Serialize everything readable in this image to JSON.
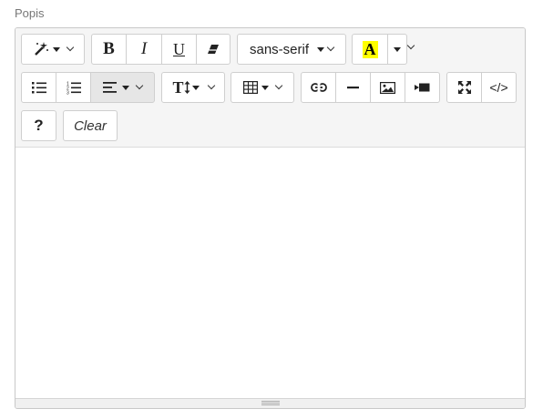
{
  "field": {
    "label": "Popis"
  },
  "toolbar": {
    "style": {
      "icon": "magic-wand-icon"
    },
    "bold": {
      "label": "B",
      "icon": "bold-icon"
    },
    "italic": {
      "label": "I",
      "icon": "italic-icon"
    },
    "underline": {
      "label": "U",
      "icon": "underline-icon"
    },
    "eraser": {
      "icon": "eraser-icon"
    },
    "font": {
      "name": "sans-serif"
    },
    "color": {
      "label": "A",
      "highlight": "#ffff00"
    },
    "unordered_list": {
      "icon": "unordered-list-icon"
    },
    "ordered_list": {
      "icon": "ordered-list-icon"
    },
    "paragraph": {
      "icon": "align-left-icon"
    },
    "line_height": {
      "label": "T",
      "icon": "text-height-icon"
    },
    "table": {
      "icon": "table-icon"
    },
    "link": {
      "icon": "link-icon"
    },
    "hr": {
      "icon": "horizontal-rule-icon"
    },
    "picture": {
      "icon": "picture-icon"
    },
    "video": {
      "icon": "video-icon"
    },
    "fullscreen": {
      "icon": "fullscreen-icon"
    },
    "codeview": {
      "label": "</>"
    },
    "help": {
      "label": "?"
    },
    "clear": {
      "label": "Clear"
    }
  },
  "editor": {
    "content": ""
  }
}
